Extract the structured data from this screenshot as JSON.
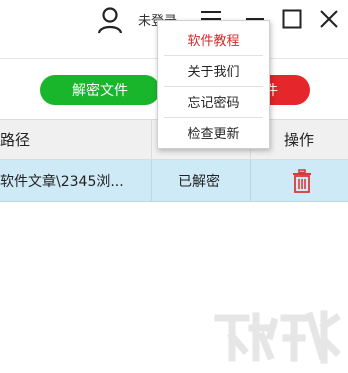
{
  "user": {
    "label": "未登录",
    "icon": "user-icon"
  },
  "window_controls": {
    "menu_icon": "hamburger-icon",
    "minimize_icon": "minimize-icon",
    "maximize_icon": "maximize-icon",
    "close_icon": "close-icon"
  },
  "actions": {
    "decrypt_label": "解密文件",
    "encrypt_label_partial": "件"
  },
  "table": {
    "headers": {
      "path": "路径",
      "operation": "操作"
    },
    "rows": [
      {
        "path": "软件文章\\2345浏...",
        "status": "已解密",
        "delete_icon": "trash-icon"
      }
    ]
  },
  "menu": {
    "items": [
      {
        "label": "软件教程"
      },
      {
        "label": "关于我们"
      },
      {
        "label": "忘记密码"
      },
      {
        "label": "检查更新"
      }
    ]
  },
  "colors": {
    "green": "#19b52b",
    "red": "#e5262a",
    "row_selected": "#cfeaf7",
    "menu_active": "#d32a2a",
    "trash": "#d83a3a"
  }
}
